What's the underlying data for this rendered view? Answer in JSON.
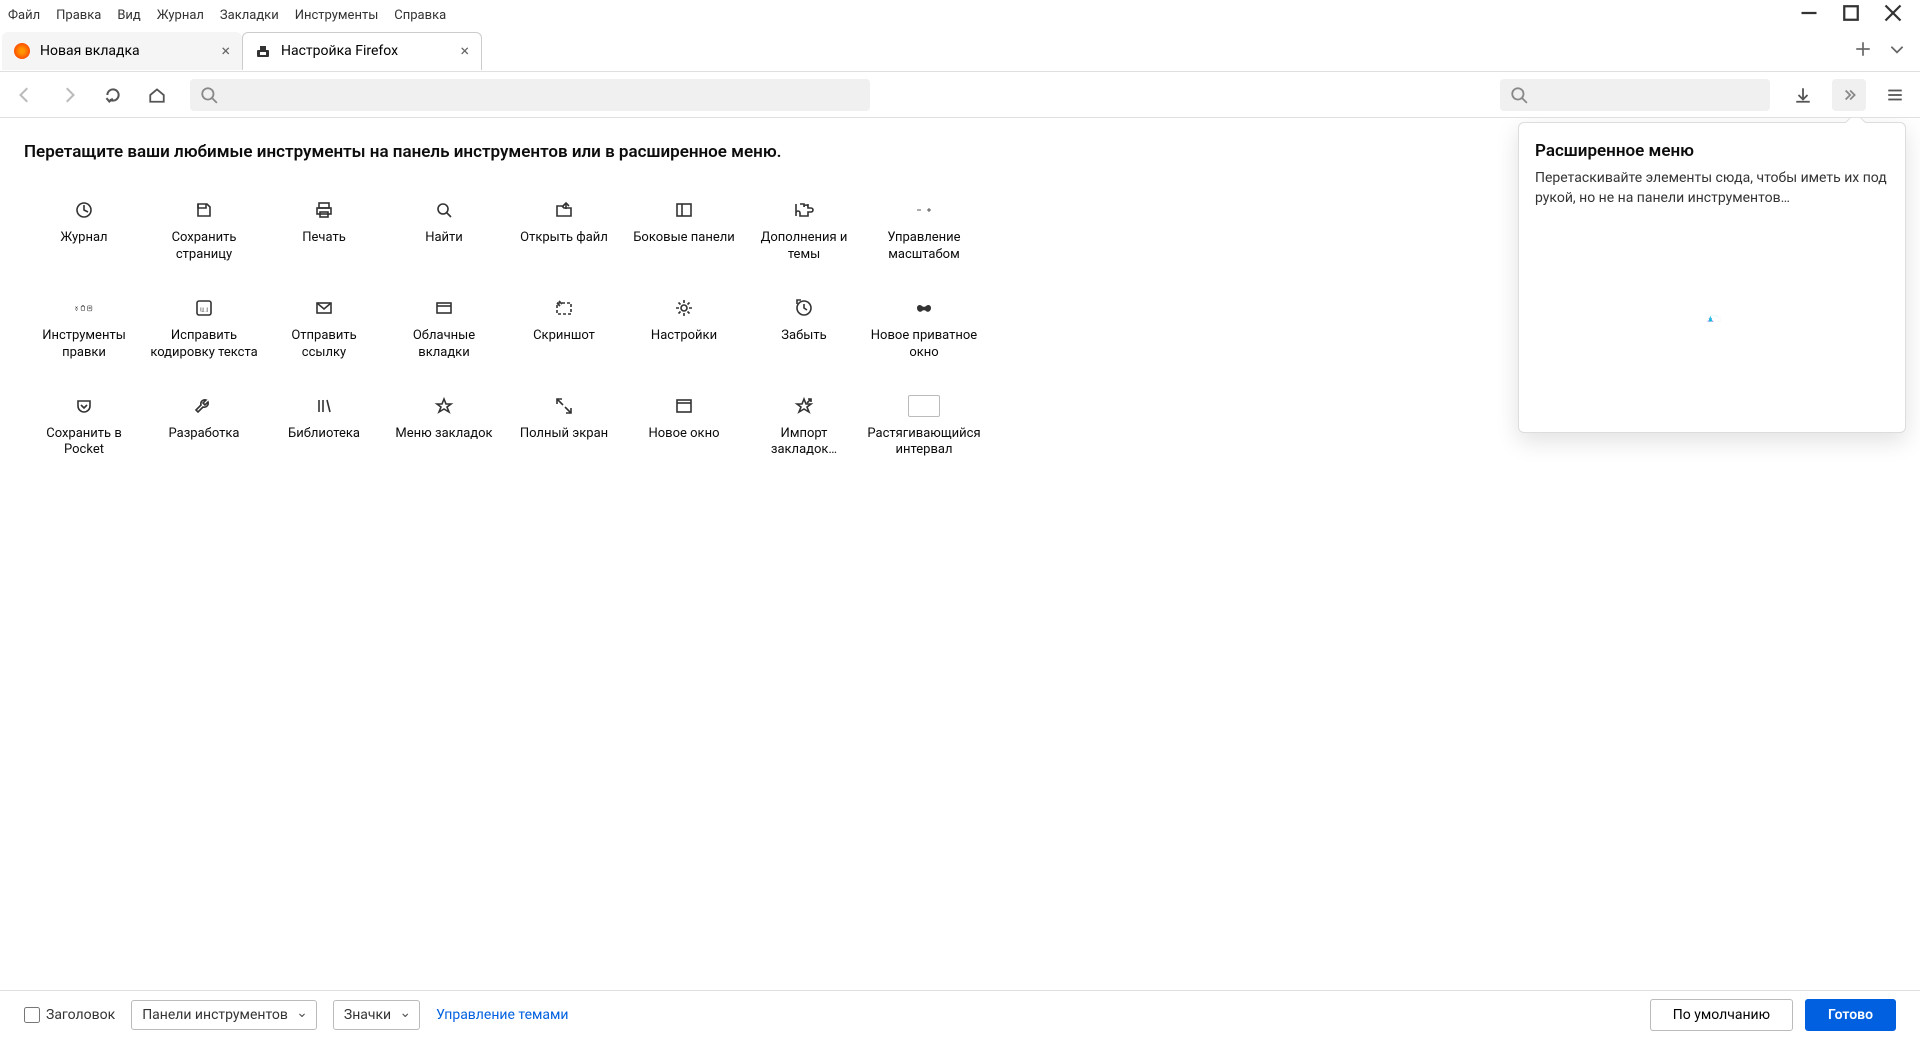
{
  "menubar": [
    "Файл",
    "Правка",
    "Вид",
    "Журнал",
    "Закладки",
    "Инструменты",
    "Справка"
  ],
  "tabs": [
    {
      "label": "Новая вкладка",
      "active": false
    },
    {
      "label": "Настройка Firefox",
      "active": true
    }
  ],
  "hint": "Перетащите ваши любимые инструменты на панель инструментов или в расширенное меню.",
  "palette": [
    {
      "label": "Журнал",
      "icon": "history"
    },
    {
      "label": "Сохранить страницу",
      "icon": "save-page"
    },
    {
      "label": "Печать",
      "icon": "print"
    },
    {
      "label": "Найти",
      "icon": "find"
    },
    {
      "label": "Открыть файл",
      "icon": "open-file"
    },
    {
      "label": "Боковые панели",
      "icon": "sidebar"
    },
    {
      "label": "Дополнения и темы",
      "icon": "addons"
    },
    {
      "label": "Управление масштабом",
      "icon": "zoom"
    },
    {
      "label": "Инструменты правки",
      "icon": "edit-tools"
    },
    {
      "label": "Исправить кодировку текста",
      "icon": "encoding"
    },
    {
      "label": "Отправить ссылку",
      "icon": "email"
    },
    {
      "label": "Облачные вкладки",
      "icon": "synced-tabs"
    },
    {
      "label": "Скриншот",
      "icon": "screenshot"
    },
    {
      "label": "Настройки",
      "icon": "settings"
    },
    {
      "label": "Забыть",
      "icon": "forget"
    },
    {
      "label": "Новое приватное окно",
      "icon": "private"
    },
    {
      "label": "Сохранить в Pocket",
      "icon": "pocket"
    },
    {
      "label": "Разработка",
      "icon": "developer"
    },
    {
      "label": "Библиотека",
      "icon": "library"
    },
    {
      "label": "Меню закладок",
      "icon": "bookmarks-menu"
    },
    {
      "label": "Полный экран",
      "icon": "fullscreen"
    },
    {
      "label": "Новое окно",
      "icon": "new-window"
    },
    {
      "label": "Импорт закладок…",
      "icon": "import"
    },
    {
      "label": "Растягивающийся интервал",
      "icon": "flex-space"
    }
  ],
  "overflow": {
    "title": "Расширенное меню",
    "desc": "Перетаскивайте элементы сюда, чтобы иметь их под рукой, но не на панели инструментов…"
  },
  "footer": {
    "titlebar_checkbox": "Заголовок",
    "toolbars_dropdown": "Панели инструментов",
    "density_dropdown": "Значки",
    "themes_link": "Управление темами",
    "defaults_button": "По умолчанию",
    "done_button": "Готово"
  }
}
